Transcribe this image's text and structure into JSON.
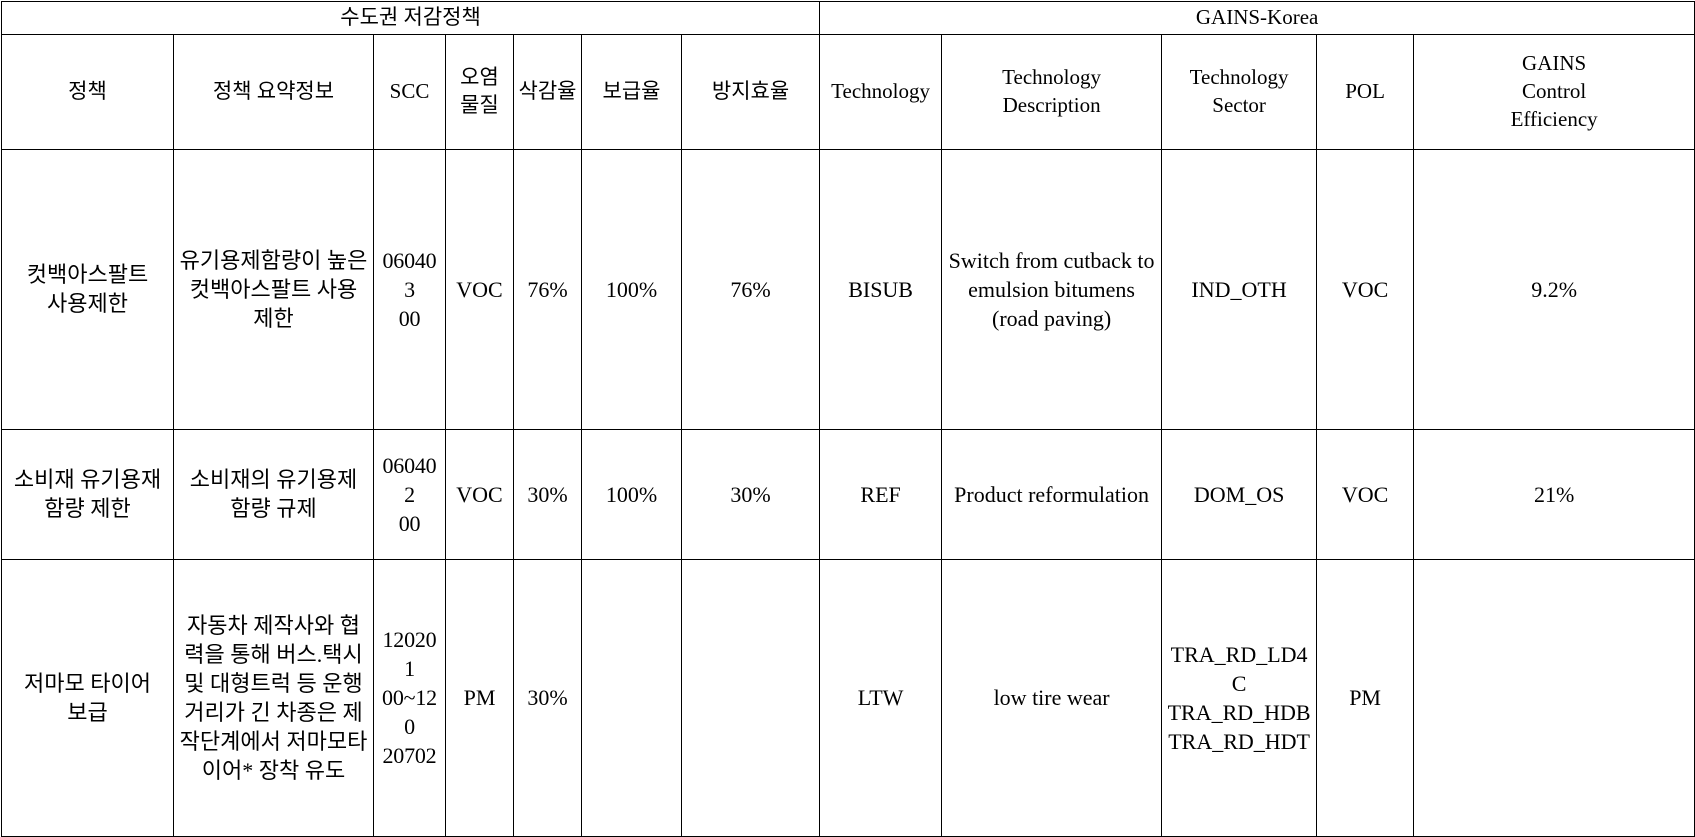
{
  "table": {
    "group_headers": [
      {
        "label": "수도권 저감정책",
        "span": 7
      },
      {
        "label": "GAINS-Korea",
        "span": 5
      }
    ],
    "columns": [
      {
        "key": "policy",
        "label": "정책"
      },
      {
        "key": "policy_summary",
        "label": "정책 요약정보"
      },
      {
        "key": "scc",
        "label": "SCC"
      },
      {
        "key": "pollutant",
        "label": "오염\n물질"
      },
      {
        "key": "reduction_rate",
        "label": "삭감율"
      },
      {
        "key": "supply_rate",
        "label": "보급율"
      },
      {
        "key": "prevention_efficiency",
        "label": "방지효율"
      },
      {
        "key": "technology",
        "label": "Technology"
      },
      {
        "key": "technology_description",
        "label": "Technology\nDescription"
      },
      {
        "key": "technology_sector",
        "label": "Technology\nSector"
      },
      {
        "key": "pol",
        "label": "POL"
      },
      {
        "key": "gains_control_efficiency",
        "label": "GAINS\nControl\nEfficiency"
      }
    ],
    "rows": [
      {
        "policy": "컷백아스팔트\n사용제한",
        "policy_summary": "유기용제함량이 높은 컷백아스팔트 사용 제한",
        "scc": "060403\n00",
        "pollutant": "VOC",
        "reduction_rate": "76%",
        "supply_rate": "100%",
        "prevention_efficiency": "76%",
        "technology": "BISUB",
        "technology_description": "Switch from cutback to emulsion bitumens (road paving)",
        "technology_sector": "IND_OTH",
        "pol": "VOC",
        "gains_control_efficiency": "9.2%"
      },
      {
        "policy": "소비재 유기용재\n함량 제한",
        "policy_summary": "소비재의 유기용제 함량 규제",
        "scc": "060402\n00",
        "pollutant": "VOC",
        "reduction_rate": "30%",
        "supply_rate": "100%",
        "prevention_efficiency": "30%",
        "technology": "REF",
        "technology_description": "Product reformulation",
        "technology_sector": "DOM_OS",
        "pol": "VOC",
        "gains_control_efficiency": "21%"
      },
      {
        "policy": "저마모 타이어\n보급",
        "policy_summary": "자동차 제작사와 협력을 통해 버스.택시 및 대형트럭 등 운행거리가 긴 차종은 제작단계에서 저마모타이어* 장착 유도",
        "scc": "120201\n00~120\n20702",
        "pollutant": "PM",
        "reduction_rate": "30%",
        "supply_rate": "",
        "prevention_efficiency": "",
        "technology": "LTW",
        "technology_description": "low tire wear",
        "technology_sector": "TRA_RD_LD4C\nTRA_RD_HDB\nTRA_RD_HDT",
        "pol": "PM",
        "gains_control_efficiency": ""
      }
    ]
  }
}
